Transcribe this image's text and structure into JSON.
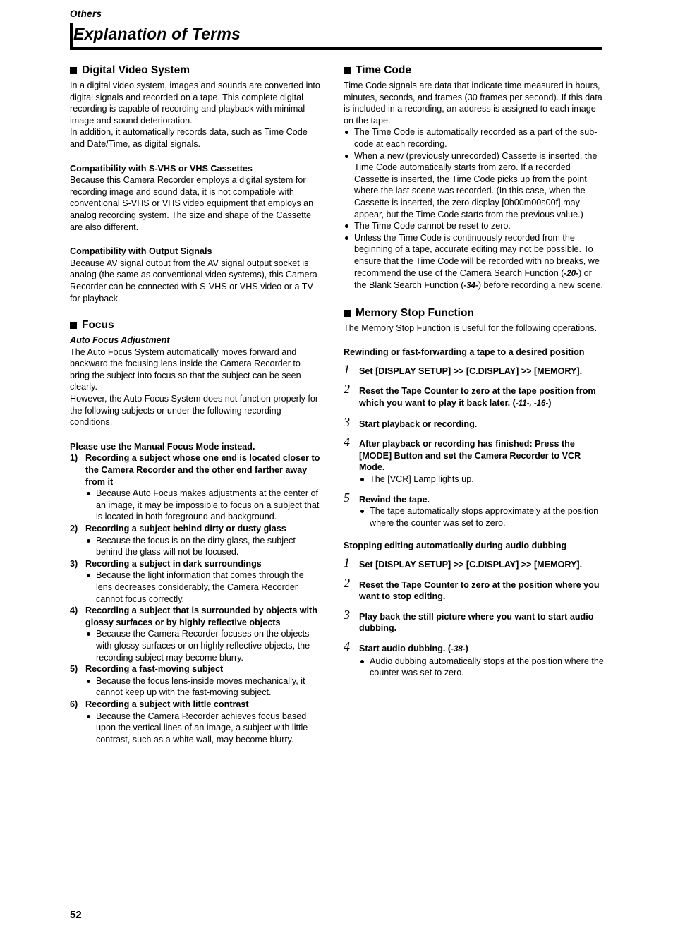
{
  "header": {
    "category": "Others",
    "title": "Explanation of Terms"
  },
  "page_number": "52",
  "left_column": {
    "s1": {
      "heading": "Digital Video System",
      "p1": "In a digital video system, images and sounds are converted into digital signals and recorded on a tape. This complete digital recording is capable of recording and playback with minimal image and sound deterioration.",
      "p2": "In addition, it automatically records data, such as Time Code and Date/Time, as digital signals.",
      "sub1": "Compatibility with S-VHS or VHS Cassettes",
      "sub1_p": "Because this Camera Recorder employs a digital system for recording image and sound data, it is not compatible with conventional S-VHS or VHS video equipment that employs an analog recording system. The size and shape of the Cassette are also different.",
      "sub2": "Compatibility with Output Signals",
      "sub2_p": "Because AV signal output from the AV signal output socket is analog (the same as conventional video systems), this Camera Recorder can be connected with S-VHS or VHS video or a TV for playback."
    },
    "s2": {
      "heading": "Focus",
      "sub1": "Auto Focus Adjustment",
      "p1": "The Auto Focus System automatically moves forward and backward the focusing lens inside the Camera Recorder to bring the subject into focus so that the subject can be seen clearly.",
      "p2": "However, the Auto Focus System does not function properly for the following subjects or under the following recording conditions.",
      "sub2": "Please use the Manual Focus Mode instead.",
      "items": [
        {
          "num": "1)",
          "text": "Recording a subject whose one end is located closer to the Camera Recorder and the other end farther away from it",
          "bullets": [
            "Because Auto Focus makes adjustments at the center of an image, it may be impossible to focus on a subject that is located in both foreground and background."
          ]
        },
        {
          "num": "2)",
          "text": "Recording a subject behind dirty or dusty glass",
          "bullets": [
            "Because the focus is on the dirty glass, the subject behind the glass will not be focused."
          ]
        },
        {
          "num": "3)",
          "text": "Recording a subject in dark surroundings",
          "bullets": [
            "Because the light information that comes through the lens decreases considerably, the Camera Recorder cannot focus correctly."
          ]
        },
        {
          "num": "4)",
          "text": "Recording a subject that is surrounded by objects with glossy surfaces or by highly reflective objects",
          "bullets": [
            "Because the Camera Recorder focuses on the objects with glossy surfaces or on highly reflective objects, the recording subject may become blurry."
          ]
        },
        {
          "num": "5)",
          "text": "Recording a fast-moving subject",
          "bullets": [
            "Because the focus lens-inside moves mechanically, it cannot keep up with the fast-moving subject."
          ]
        },
        {
          "num": "6)",
          "text": "Recording a subject with little contrast",
          "bullets": [
            "Because the Camera Recorder achieves focus based upon the vertical lines of an image, a subject with little contrast, such as a white wall, may become blurry."
          ]
        }
      ]
    }
  },
  "right_column": {
    "s1": {
      "heading": "Time Code",
      "p1": "Time Code signals are data that indicate time measured in hours, minutes, seconds, and frames (30 frames per second). If this data is included in a recording, an address is assigned to each image on the tape.",
      "bullets": [
        "The Time Code is automatically recorded as a part of the sub-code at each recording.",
        "When a new (previously unrecorded) Cassette is inserted, the Time Code automatically starts from zero. If a recorded Cassette is inserted, the Time Code picks up from the point where the last scene was recorded. (In this case, when the Cassette is inserted, the zero display [0h00m00s00f] may appear, but the Time Code starts from the previous value.)",
        "The Time Code cannot be reset to zero."
      ],
      "last_bullet_part1": "Unless the Time Code is continuously recorded from the beginning of a tape, accurate editing may not be possible. To ensure that the Time Code will be recorded with no breaks, we recommend the use of the Camera Search Function (",
      "last_bullet_ref1": "-20-",
      "last_bullet_part2": ") or the Blank Search Function (",
      "last_bullet_ref2": "-34-",
      "last_bullet_part3": ") before recording a new scene."
    },
    "s2": {
      "heading": "Memory Stop Function",
      "p1": "The Memory Stop Function is useful for the following operations.",
      "sub1": "Rewinding or fast-forwarding a tape to a desired position",
      "steps1": [
        {
          "num": "1",
          "text": "Set [DISPLAY SETUP] >> [C.DISPLAY] >> [MEMORY]."
        },
        {
          "num": "2",
          "text": "Reset the Tape Counter to zero at the tape position from which you want to play it back later. (",
          "ref": "-11-, -16-",
          "text_after": ")"
        },
        {
          "num": "3",
          "text": "Start playback or recording."
        },
        {
          "num": "4",
          "text": "After playback or recording has finished: Press the [MODE] Button and set the Camera Recorder to VCR Mode.",
          "bullets": [
            "The [VCR] Lamp lights up."
          ]
        },
        {
          "num": "5",
          "text": "Rewind the tape.",
          "bullets": [
            "The tape automatically stops approximately at the position where the counter was set to zero."
          ]
        }
      ],
      "sub2": "Stopping editing automatically during audio dubbing",
      "steps2": [
        {
          "num": "1",
          "text": "Set [DISPLAY SETUP] >> [C.DISPLAY] >> [MEMORY]."
        },
        {
          "num": "2",
          "text": "Reset the Tape Counter to zero at the position where you want to stop editing."
        },
        {
          "num": "3",
          "text": "Play back the still picture where you want to start audio dubbing."
        },
        {
          "num": "4",
          "text": "Start audio dubbing. (",
          "ref": "-38-",
          "text_after": ")",
          "bullets": [
            "Audio dubbing automatically stops at the position where the counter was set to zero."
          ]
        }
      ]
    }
  }
}
